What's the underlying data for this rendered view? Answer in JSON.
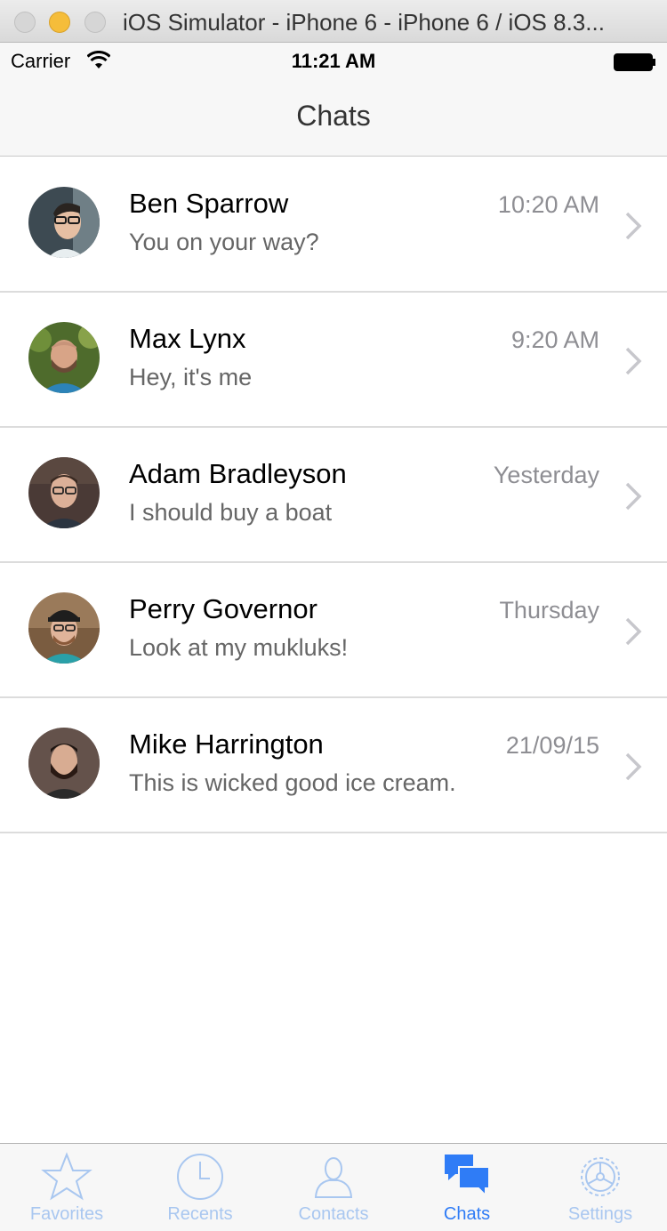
{
  "window": {
    "title": "iOS Simulator - iPhone 6 - iPhone 6 / iOS 8.3..."
  },
  "status_bar": {
    "carrier": "Carrier",
    "time": "11:21 AM"
  },
  "nav": {
    "title": "Chats"
  },
  "chats": [
    {
      "name": "Ben Sparrow",
      "message": "You on your way?",
      "time": "10:20 AM"
    },
    {
      "name": "Max Lynx",
      "message": "Hey, it's me",
      "time": "9:20 AM"
    },
    {
      "name": "Adam Bradleyson",
      "message": "I should buy a boat",
      "time": "Yesterday"
    },
    {
      "name": "Perry Governor",
      "message": "Look at my mukluks!",
      "time": "Thursday"
    },
    {
      "name": "Mike Harrington",
      "message": "This is wicked good ice cream.",
      "time": "21/09/15"
    }
  ],
  "tabs": [
    {
      "label": "Favorites",
      "icon": "star-icon",
      "active": false
    },
    {
      "label": "Recents",
      "icon": "clock-icon",
      "active": false
    },
    {
      "label": "Contacts",
      "icon": "person-icon",
      "active": false
    },
    {
      "label": "Chats",
      "icon": "chat-bubbles-icon",
      "active": true
    },
    {
      "label": "Settings",
      "icon": "gear-icon",
      "active": false
    }
  ],
  "colors": {
    "accent": "#2f7cf6",
    "inactive_tab": "#a9c7f0",
    "secondary_text": "#8e8e93"
  }
}
